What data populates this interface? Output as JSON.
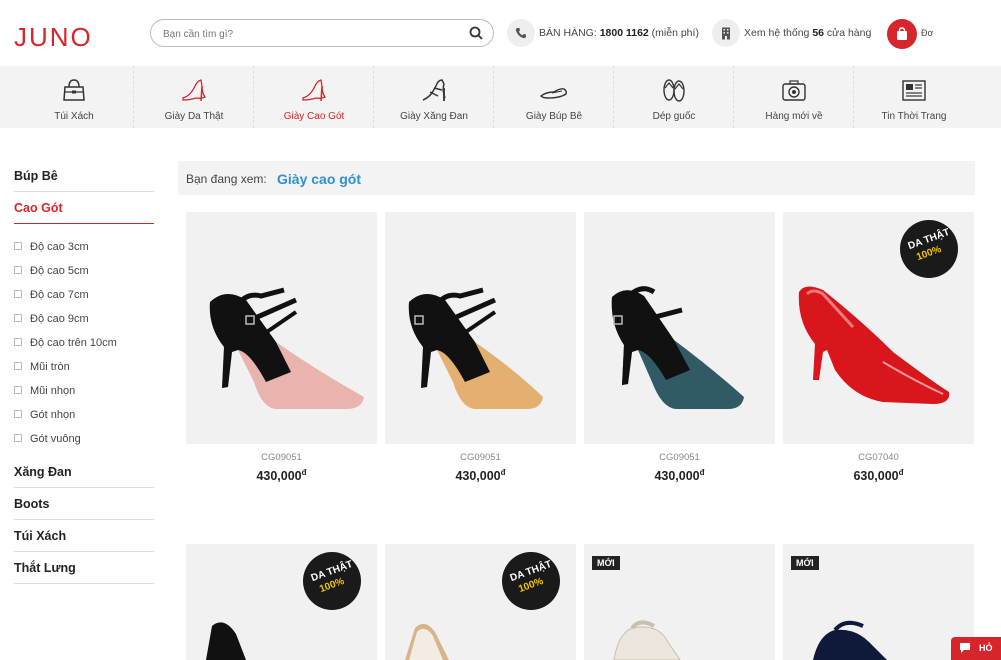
{
  "header": {
    "logo": "JUNO",
    "search_placeholder": "Bạn cần tìm gì?",
    "hotline_label": "BÁN HÀNG:",
    "hotline_number": "1800 1162",
    "hotline_note": "(miễn phí)",
    "stores_pre": "Xem hệ thống",
    "stores_count": "56",
    "stores_post": "cửa hàng",
    "cart_label": "Đơ"
  },
  "categories": [
    {
      "label": "Túi Xách",
      "icon": "handbag-icon"
    },
    {
      "label": "Giày Da Thật",
      "icon": "heel-shoe-icon"
    },
    {
      "label": "Giày Cao Gót",
      "icon": "high-heel-icon",
      "active": true
    },
    {
      "label": "Giày Xăng Đan",
      "icon": "sandal-icon"
    },
    {
      "label": "Giày Búp Bê",
      "icon": "flat-shoe-icon"
    },
    {
      "label": "Dép guốc",
      "icon": "flip-flop-icon"
    },
    {
      "label": "Hàng mới về",
      "icon": "camera-icon"
    },
    {
      "label": "Tin Thời Trang",
      "icon": "newspaper-icon"
    }
  ],
  "sidebar": {
    "group1": "Búp Bê",
    "group2": "Cao Gót",
    "filters": [
      "Độ cao 3cm",
      "Độ cao 5cm",
      "Độ cao 7cm",
      "Độ cao 9cm",
      "Độ cao trên 10cm",
      "Mũi tròn",
      "Mũi nhọn",
      "Gót nhọn",
      "Gót vuông"
    ],
    "group3": "Xăng Đan",
    "group4": "Boots",
    "group5": "Túi Xách",
    "group6": "Thắt Lưng"
  },
  "breadcrumb": {
    "prefix": "Bạn đang xem:",
    "current": "Giày cao gót"
  },
  "products": [
    {
      "code": "CG09051",
      "price": "430,000",
      "currency": "đ",
      "color": "#e8b4ad"
    },
    {
      "code": "CG09051",
      "price": "430,000",
      "currency": "đ",
      "color": "#e3b071"
    },
    {
      "code": "CG09051",
      "price": "430,000",
      "currency": "đ",
      "color": "#2f5a66"
    },
    {
      "code": "CG07040",
      "price": "630,000",
      "currency": "đ",
      "color": "#d8161c"
    }
  ],
  "badges": {
    "leather_l1": "DA THẬT",
    "leather_l2": "100%",
    "new": "MỚI"
  },
  "chat_label": "HỎ",
  "colors": {
    "brand": "#d7262b",
    "link": "#2f8fd8"
  }
}
